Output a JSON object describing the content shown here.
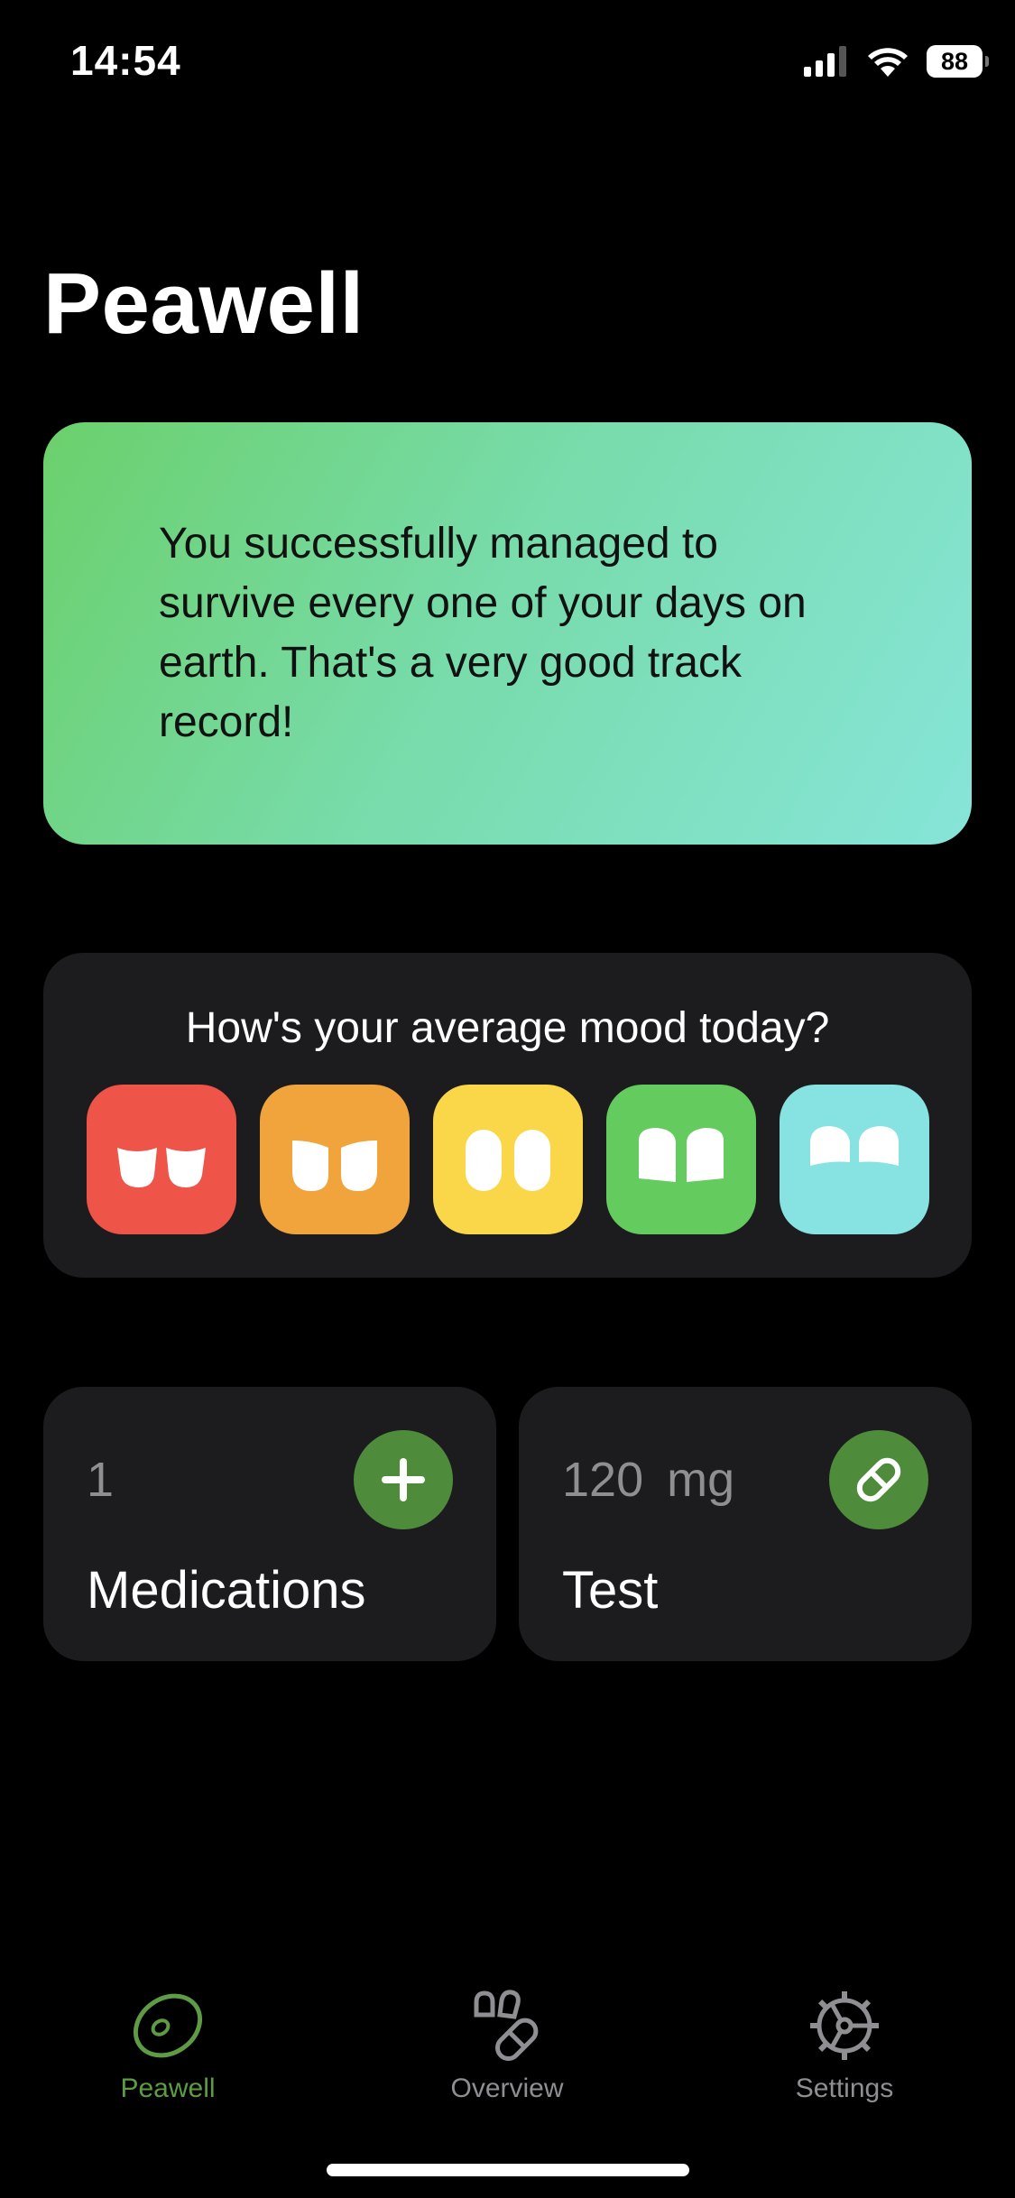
{
  "status_bar": {
    "time": "14:54",
    "battery": "88"
  },
  "app": {
    "title": "Peawell"
  },
  "quote": {
    "text": "You successfully managed to survive every one of your days on earth. That's a very good track record!"
  },
  "mood": {
    "question": "How's your average mood today?",
    "options": [
      {
        "id": "very-bad",
        "color": "#ee5447"
      },
      {
        "id": "bad",
        "color": "#f1a33c"
      },
      {
        "id": "neutral",
        "color": "#f9d749"
      },
      {
        "id": "good",
        "color": "#64cc5e"
      },
      {
        "id": "very-good",
        "color": "#86e3e2"
      }
    ]
  },
  "medications_card": {
    "count": "1",
    "label": "Medications",
    "action_icon": "plus-icon"
  },
  "test_card": {
    "dose": "120",
    "unit": "mg",
    "label": "Test",
    "action_icon": "pill-icon"
  },
  "tabs": [
    {
      "label": "Peawell",
      "icon": "pea-icon",
      "active": true
    },
    {
      "label": "Overview",
      "icon": "pills-icon",
      "active": false
    },
    {
      "label": "Settings",
      "icon": "gear-icon",
      "active": false
    }
  ],
  "colors": {
    "accent": "#5e9b45",
    "card_background": "#1c1c1e",
    "action_button": "#4e8c3c"
  }
}
